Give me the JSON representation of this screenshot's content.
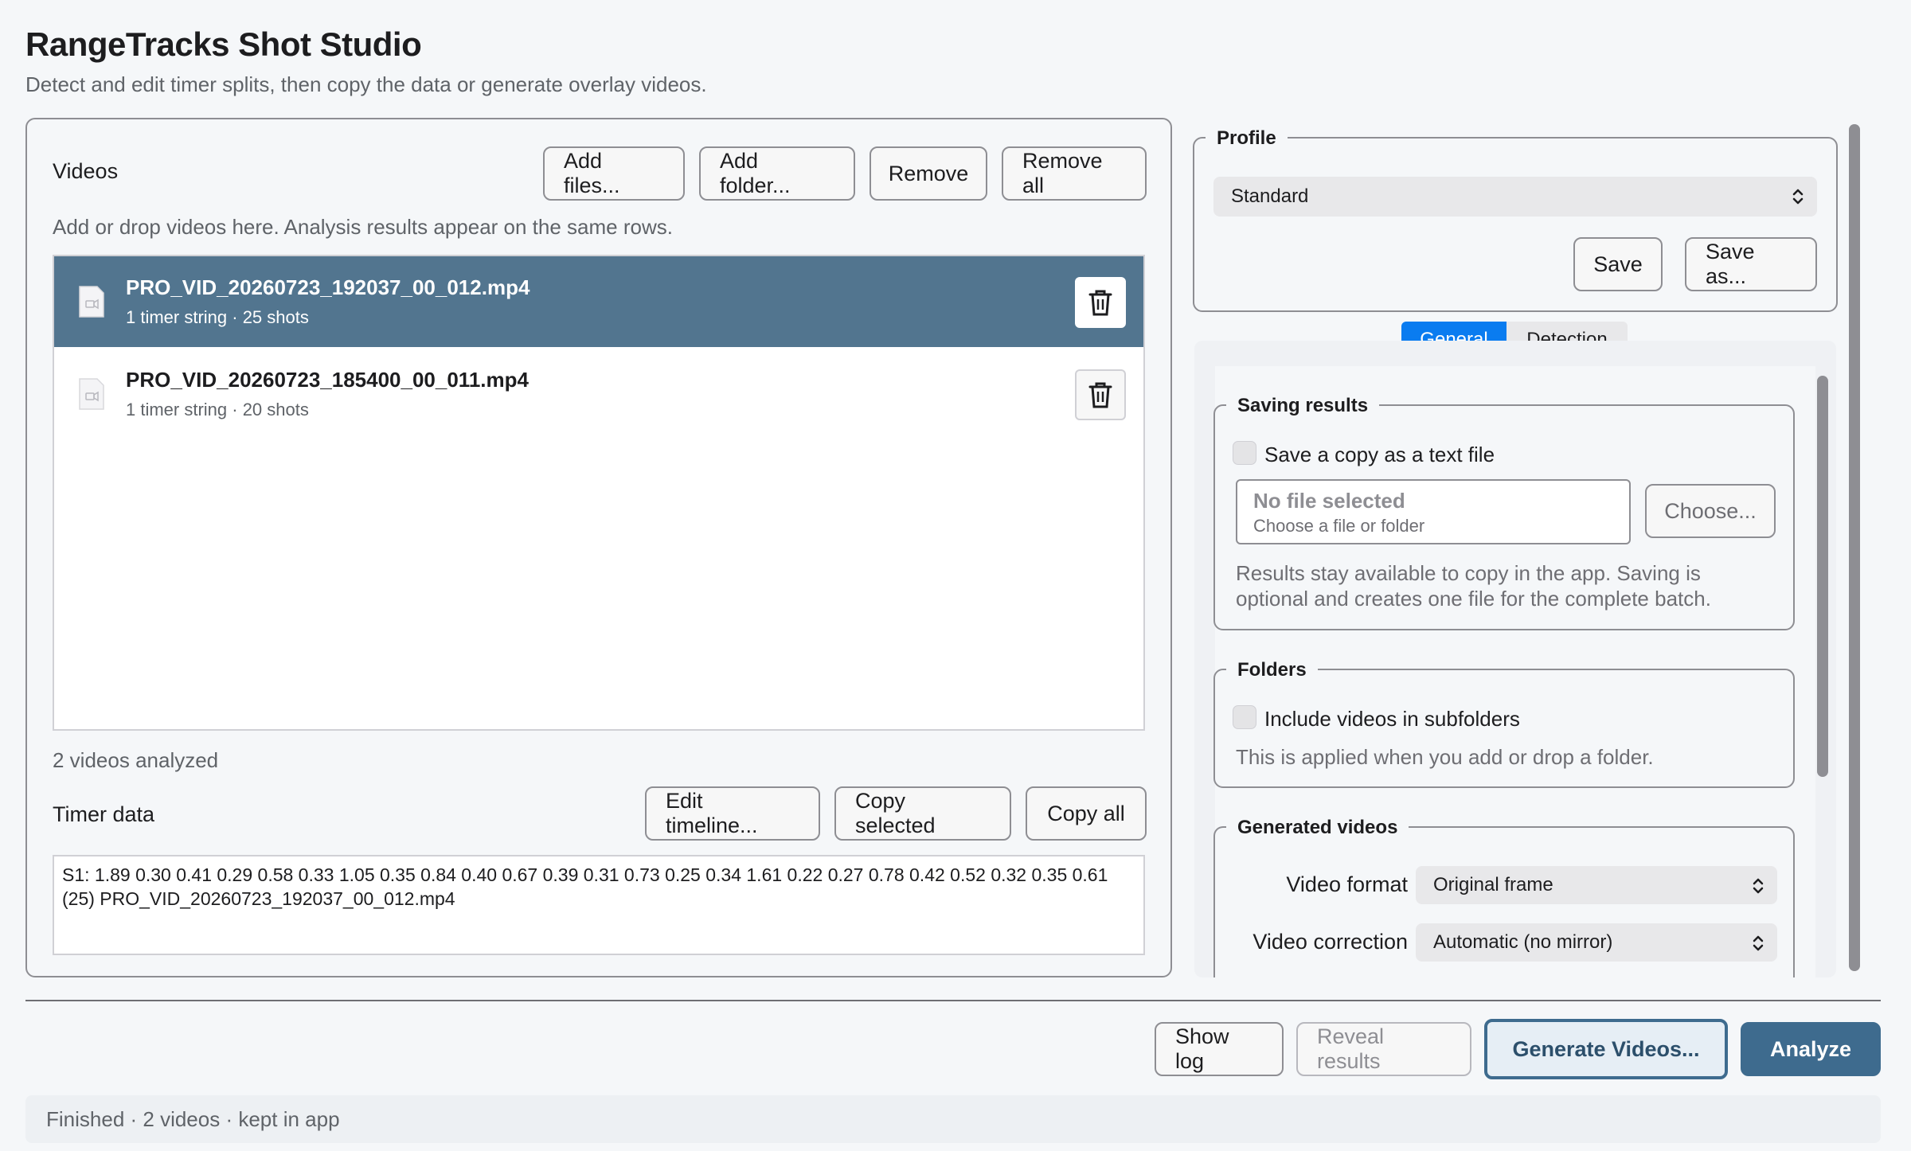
{
  "app": {
    "title": "RangeTracks Shot Studio",
    "subtitle": "Detect and edit timer splits, then copy the data or generate overlay videos."
  },
  "videos": {
    "label": "Videos",
    "add_files": "Add files...",
    "add_folder": "Add folder...",
    "remove": "Remove",
    "remove_all": "Remove all",
    "hint": "Add or drop videos here. Analysis results appear on the same rows.",
    "files": [
      {
        "name": "PRO_VID_20260723_192037_00_012.mp4",
        "meta": "1 timer string · 25 shots",
        "selected": true
      },
      {
        "name": "PRO_VID_20260723_185400_00_011.mp4",
        "meta": "1 timer string · 20 shots",
        "selected": false
      }
    ],
    "count_text": "2 videos analyzed"
  },
  "timer": {
    "label": "Timer data",
    "edit_timeline": "Edit timeline...",
    "copy_selected": "Copy selected",
    "copy_all": "Copy all",
    "content": "S1: 1.89 0.30 0.41 0.29 0.58 0.33 1.05 0.35 0.84 0.40 0.67 0.39 0.31 0.73 0.25 0.34 1.61 0.22 0.27 0.78 0.42 0.52 0.32 0.35 0.61 (25) PRO_VID_20260723_192037_00_012.mp4"
  },
  "profile": {
    "legend": "Profile",
    "selected": "Standard",
    "save": "Save",
    "save_as": "Save as..."
  },
  "tabs": {
    "general": "General",
    "detection": "Detection",
    "active": "general"
  },
  "saving": {
    "legend": "Saving results",
    "checkbox_label": "Save a copy as a text file",
    "file_value": "No file selected",
    "file_hint": "Choose a file or folder",
    "choose": "Choose...",
    "note": "Results stay available to copy in the app. Saving is optional and creates one file for the complete batch."
  },
  "folders": {
    "legend": "Folders",
    "checkbox_label": "Include videos in subfolders",
    "note": "This is applied when you add or drop a folder."
  },
  "generated": {
    "legend": "Generated videos",
    "format_label": "Video format",
    "format_value": "Original frame",
    "correction_label": "Video correction",
    "correction_value": "Automatic (no mirror)"
  },
  "actions": {
    "show_log": "Show log",
    "reveal_results": "Reveal results",
    "generate_videos": "Generate Videos...",
    "analyze": "Analyze"
  },
  "status": "Finished · 2 videos · kept in app",
  "colors": {
    "selected_row": "#52758f",
    "tab_active": "#0a7cf0",
    "analyze": "#3e6b8e",
    "generate_bg": "#e6eef5",
    "generate_border": "#3e6b8e"
  }
}
